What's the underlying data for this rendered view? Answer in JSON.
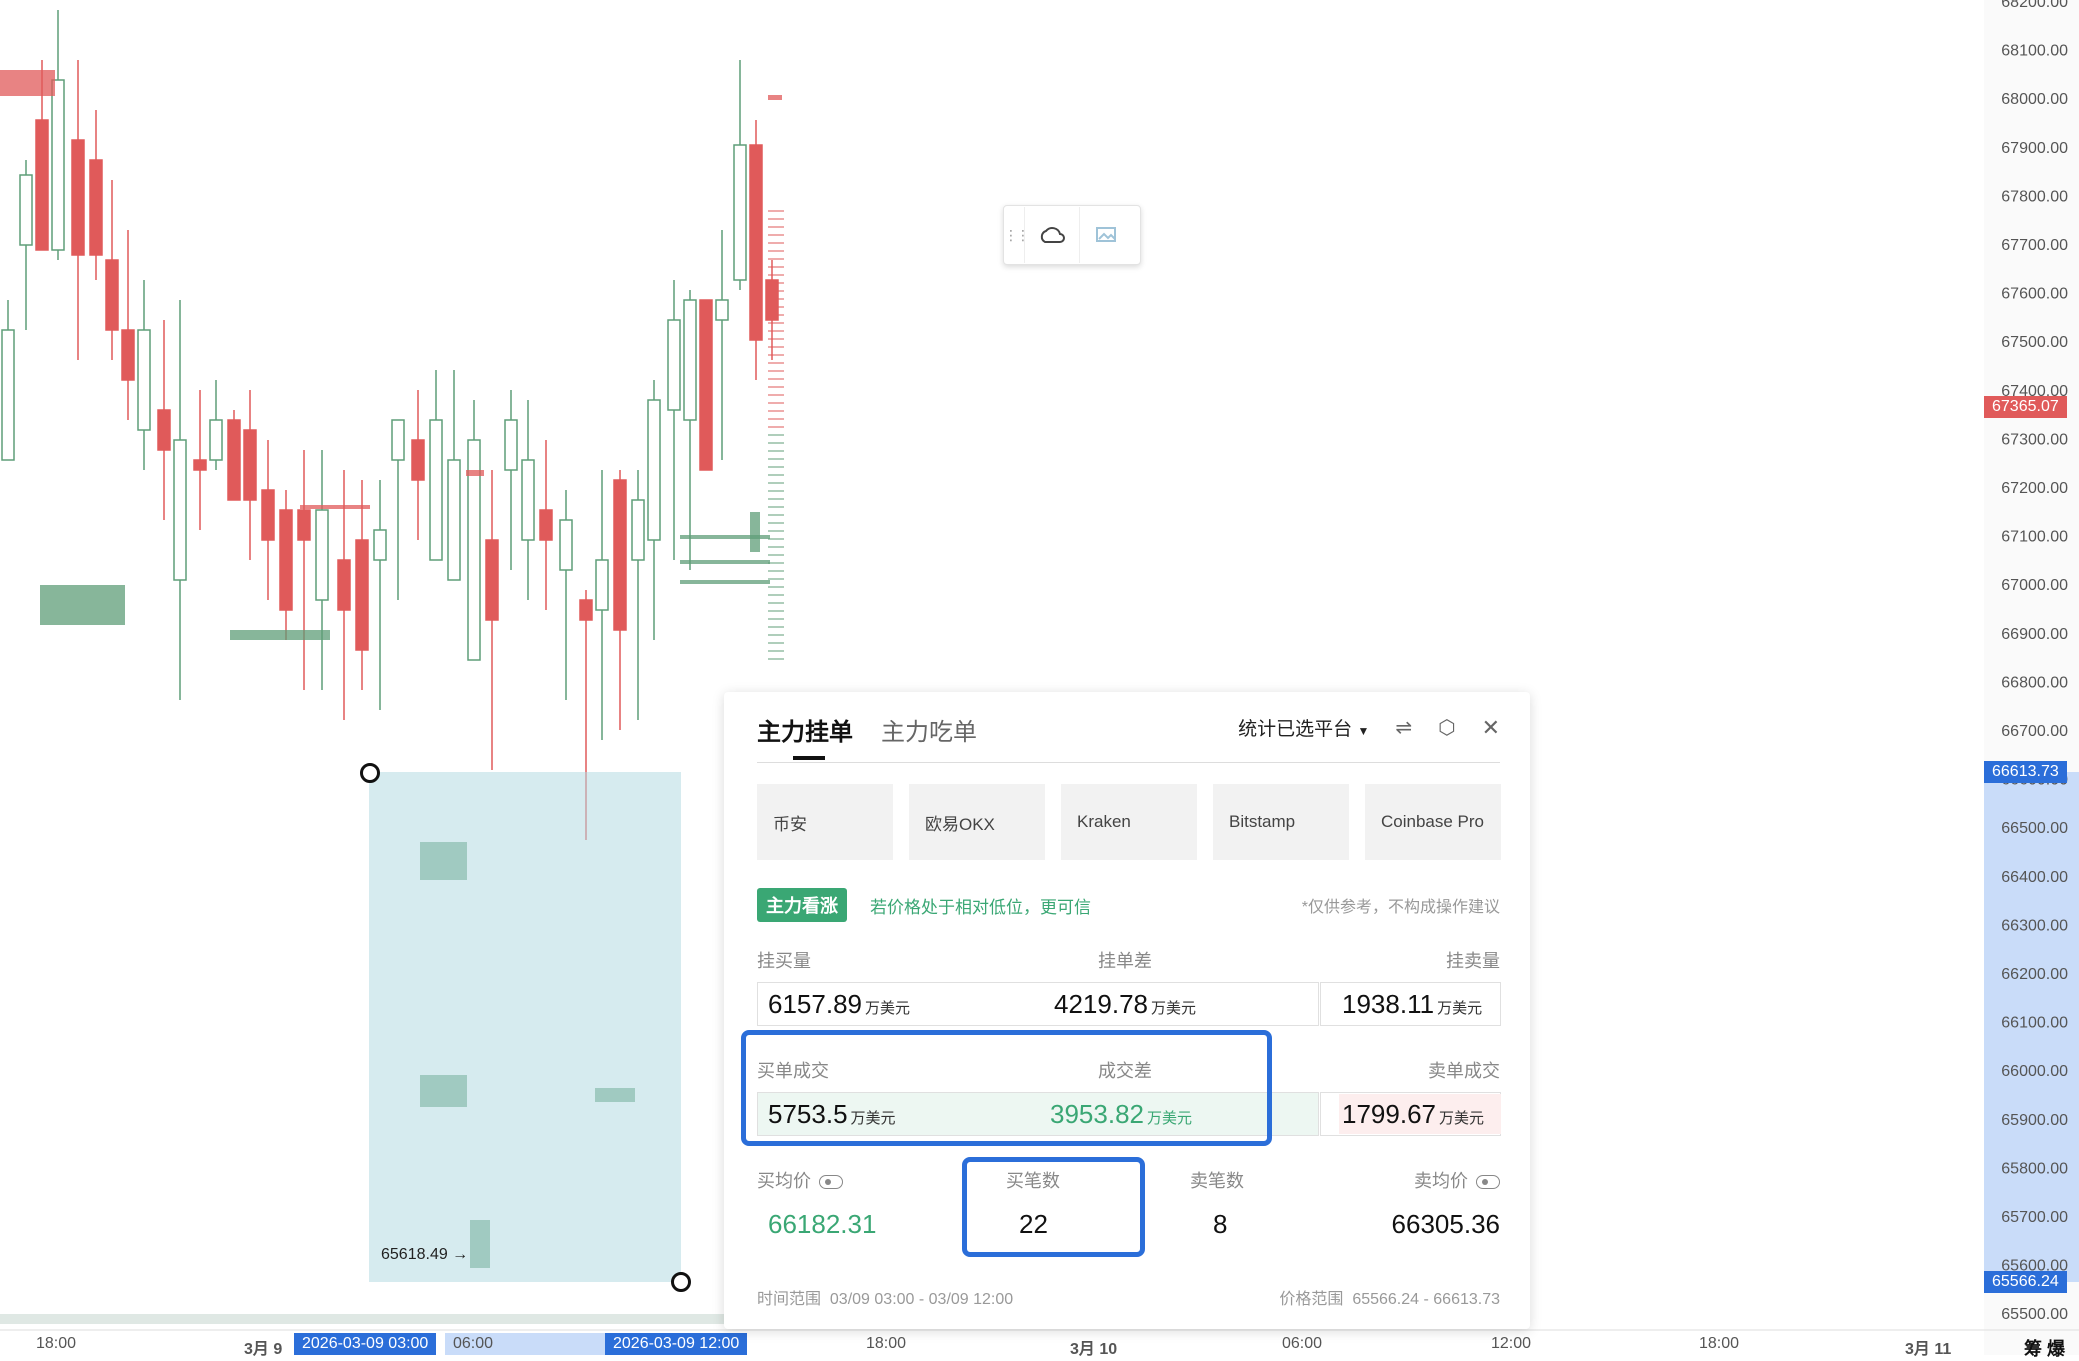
{
  "y_axis": {
    "labels": [
      "68200.00",
      "68100.00",
      "68000.00",
      "67900.00",
      "67800.00",
      "67700.00",
      "67600.00",
      "67500.00",
      "67400.00",
      "67300.00",
      "67200.00",
      "67100.00",
      "67000.00",
      "66900.00",
      "66800.00",
      "66700.00",
      "66600.00",
      "66500.00",
      "66400.00",
      "66300.00",
      "66200.00",
      "66100.00",
      "66000.00",
      "65900.00",
      "65800.00",
      "65700.00",
      "65600.00",
      "65500.00"
    ],
    "current_price": "67365.07",
    "range_high": "66613.73",
    "range_low": "65566.24"
  },
  "x_axis": {
    "labels": [
      "18:00",
      "3月 9",
      "06:00",
      "18:00",
      "3月 10",
      "06:00",
      "12:00",
      "18:00",
      "3月 11"
    ],
    "start_marker": "2026-03-09 03:00",
    "end_marker": "2026-03-09 12:00",
    "corner": "筹 爆"
  },
  "chart": {
    "range_low_annotation": "65618.49 →"
  },
  "colors": {
    "up": "#5f9e78",
    "down": "#e05a5a",
    "selection": "#cfe8ec",
    "accent_blue": "#2b6ed9",
    "green_text": "#3aa774"
  },
  "panel": {
    "tabs": [
      "主力挂单",
      "主力吃单"
    ],
    "platform_select": "统计已选平台",
    "swap_icon": "swap-icon",
    "settings_icon": "settings-icon",
    "close_icon": "close-icon",
    "exchanges": [
      "币安",
      "欧易OKX",
      "Kraken",
      "Bitstamp",
      "Coinbase Pro"
    ],
    "badge": "主力看涨",
    "hint": "若价格处于相对低位，更可信",
    "disclaimer": "*仅供参考，不构成操作建议",
    "orders": {
      "buy_label": "挂买量",
      "diff_label": "挂单差",
      "sell_label": "挂卖量",
      "buy_value": "6157.89",
      "diff_value": "4219.78",
      "sell_value": "1938.11",
      "unit": "万美元"
    },
    "trades": {
      "buy_label": "买单成交",
      "diff_label": "成交差",
      "sell_label": "卖单成交",
      "buy_value": "5753.5",
      "diff_value": "3953.82",
      "sell_value": "1799.67",
      "unit": "万美元"
    },
    "stats": {
      "buy_avg_label": "买均价",
      "buy_count_label": "买笔数",
      "sell_count_label": "卖笔数",
      "sell_avg_label": "卖均价",
      "buy_avg": "66182.31",
      "buy_count": "22",
      "sell_count": "8",
      "sell_avg": "66305.36"
    },
    "footer": {
      "time_label": "时间范围",
      "time_value": "03/09 03:00 - 03/09 12:00",
      "price_label": "价格范围",
      "price_value": "65566.24 - 66613.73"
    }
  }
}
